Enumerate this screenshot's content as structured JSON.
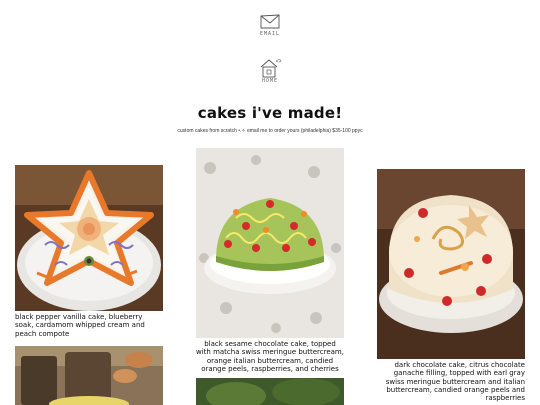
{
  "nav": {
    "email_label": "EMAIL",
    "home_label": "HOME"
  },
  "page": {
    "title": "cakes i've made!",
    "subtitle": "custom cakes from scratch •.✧ email me to order yours (philadelphia) $35-100 ppyc"
  },
  "cakes": [
    {
      "caption": "black pepper vanilla cake, blueberry soak, cardamom whipped cream and peach compote"
    },
    {
      "caption": "black sesame chocolate cake, topped with matcha swiss meringue buttercream, orange italian buttercream, candied orange peels, raspberries, and cherries"
    },
    {
      "caption": "dark chocolate cake, citrus chocolate ganache filling, topped with earl gray swiss meringue buttercream and italian buttercream, candied orange peels and raspberries"
    }
  ],
  "colors": {
    "background": "#ffffff",
    "text": "#111111"
  },
  "icons": [
    "envelope-icon",
    "house-icon"
  ]
}
